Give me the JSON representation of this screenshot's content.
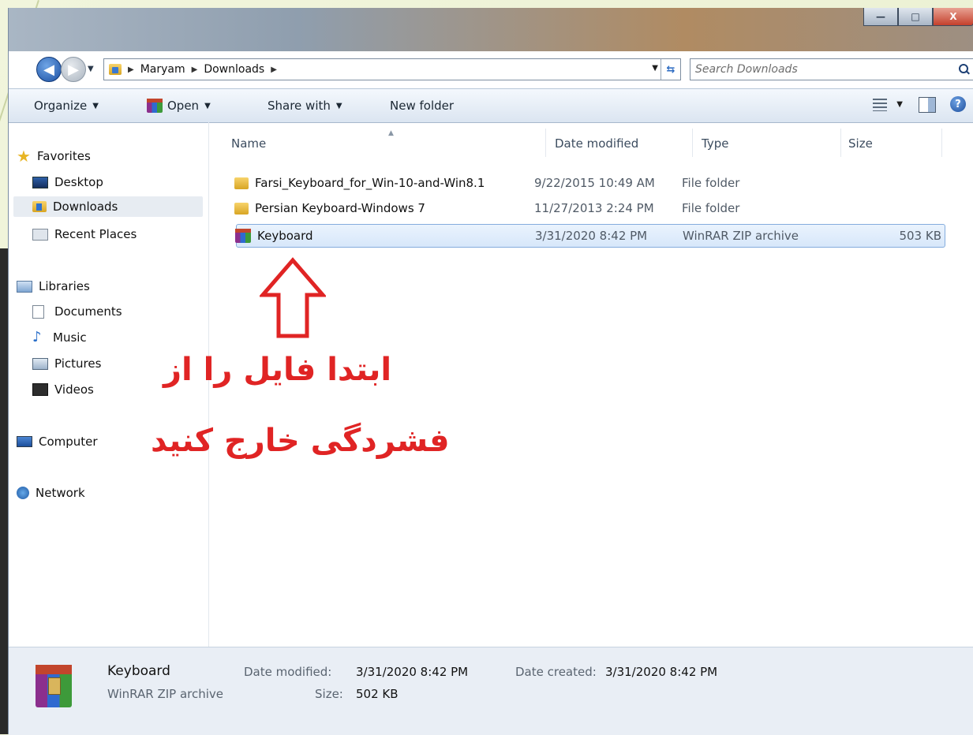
{
  "window": {
    "controls": [
      "—",
      "□",
      "X"
    ]
  },
  "address": {
    "crumbs": [
      "Maryam",
      "Downloads"
    ],
    "search_placeholder": "Search Downloads"
  },
  "toolbar": {
    "organize": "Organize",
    "open": "Open",
    "share_with": "Share with",
    "new_folder": "New folder"
  },
  "sidebar": {
    "favorites": "Favorites",
    "desktop": "Desktop",
    "downloads": "Downloads",
    "recent_places": "Recent Places",
    "libraries": "Libraries",
    "documents": "Documents",
    "music": "Music",
    "pictures": "Pictures",
    "videos": "Videos",
    "computer": "Computer",
    "network": "Network"
  },
  "columns": {
    "name": "Name",
    "date_modified": "Date modified",
    "type": "Type",
    "size": "Size"
  },
  "files": [
    {
      "name": "Farsi_Keyboard_for_Win-10-and-Win8.1",
      "date": "9/22/2015 10:49 AM",
      "type": "File folder",
      "size": ""
    },
    {
      "name": "Persian Keyboard-Windows 7",
      "date": "11/27/2013 2:24 PM",
      "type": "File folder",
      "size": ""
    },
    {
      "name": "Keyboard",
      "date": "3/31/2020 8:42 PM",
      "type": "WinRAR ZIP archive",
      "size": "503 KB"
    }
  ],
  "annotation": {
    "line1": "ابتدا فایل را از",
    "line2": "فشردگی خارج کنید",
    "color": "#e02424"
  },
  "details": {
    "name": "Keyboard",
    "type": "WinRAR ZIP archive",
    "modified_label": "Date modified:",
    "modified_value": "3/31/2020 8:42 PM",
    "size_label": "Size:",
    "size_value": "502 KB",
    "created_label": "Date created:",
    "created_value": "3/31/2020 8:42 PM"
  }
}
